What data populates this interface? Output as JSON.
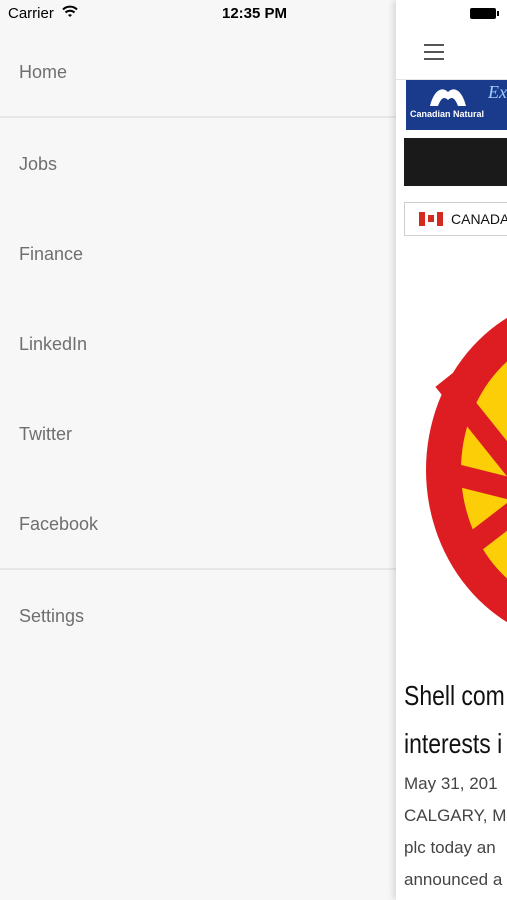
{
  "status_bar": {
    "carrier": "Carrier",
    "time": "12:35 PM"
  },
  "menu": {
    "items": [
      {
        "label": "Home"
      },
      {
        "label": "Jobs"
      },
      {
        "label": "Finance"
      },
      {
        "label": "LinkedIn"
      },
      {
        "label": "Twitter"
      },
      {
        "label": "Facebook"
      },
      {
        "label": "Settings"
      }
    ]
  },
  "content": {
    "ad": {
      "brand": "Canadian Natural",
      "tagline": "Ex"
    },
    "country": "CANADA",
    "headline_line1": "Shell com",
    "headline_line2": "interests i",
    "body_lines": [
      "May 31, 201",
      "CALGARY, M",
      "plc today an",
      "announced a"
    ]
  },
  "colors": {
    "menu_bg": "#f7f7f7",
    "menu_text": "#6f6f6f",
    "ad_bg": "#1a3a8c",
    "shell_red": "#dd1d21",
    "shell_yellow": "#fbce07"
  }
}
